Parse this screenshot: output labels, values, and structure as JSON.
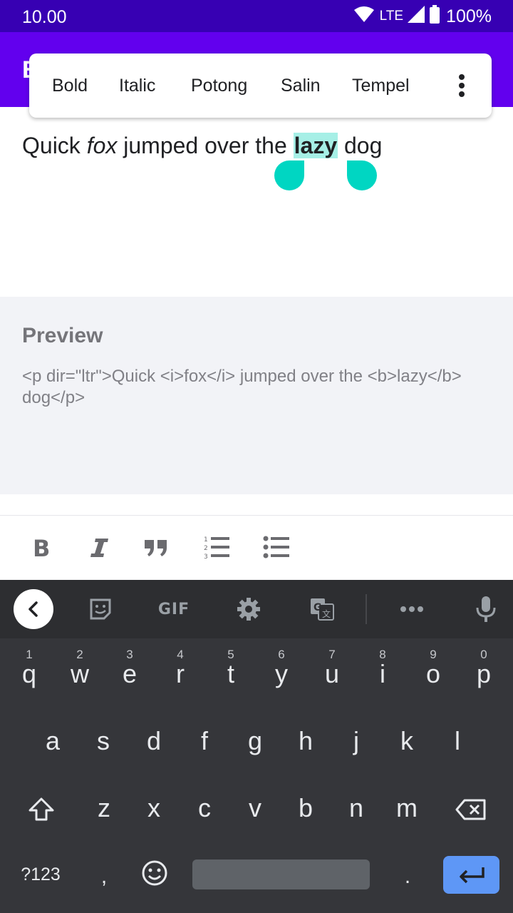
{
  "status_bar": {
    "time": "10.00",
    "network": "LTE",
    "battery": "100%"
  },
  "app_bar": {
    "title": "E"
  },
  "selection_toolbar": {
    "items": [
      "Bold",
      "Italic",
      "Potong",
      "Salin",
      "Tempel"
    ],
    "more_icon": "more-vert-icon"
  },
  "editor": {
    "text_before": "Quick ",
    "text_italic": "fox",
    "text_middle": " jumped over the ",
    "text_selected": "lazy",
    "text_after": " dog",
    "selection_color": "#a6efe6",
    "handle_color": "#00d6c2"
  },
  "preview": {
    "heading": "Preview",
    "html": "<p dir=\"ltr\">Quick <i>fox</i> jumped over the <b>lazy</b> dog</p>"
  },
  "format_toolbar": {
    "icons": [
      "bold-icon",
      "italic-icon",
      "quote-icon",
      "numbered-list-icon",
      "bulleted-list-icon"
    ]
  },
  "keyboard": {
    "toolbar": {
      "gif_label": "GIF",
      "icons": [
        "collapse-icon",
        "sticker-icon",
        "gif",
        "settings-icon",
        "translate-icon",
        "more-icon",
        "mic-icon"
      ]
    },
    "row1": [
      {
        "ch": "q",
        "num": "1"
      },
      {
        "ch": "w",
        "num": "2"
      },
      {
        "ch": "e",
        "num": "3"
      },
      {
        "ch": "r",
        "num": "4"
      },
      {
        "ch": "t",
        "num": "5"
      },
      {
        "ch": "y",
        "num": "6"
      },
      {
        "ch": "u",
        "num": "7"
      },
      {
        "ch": "i",
        "num": "8"
      },
      {
        "ch": "o",
        "num": "9"
      },
      {
        "ch": "p",
        "num": "0"
      }
    ],
    "row2": [
      "a",
      "s",
      "d",
      "f",
      "g",
      "h",
      "j",
      "k",
      "l"
    ],
    "row3": [
      "z",
      "x",
      "c",
      "v",
      "b",
      "n",
      "m"
    ],
    "symbols_label": "?123",
    "comma": ",",
    "period": ".",
    "accent_color": "#5e97f6"
  }
}
